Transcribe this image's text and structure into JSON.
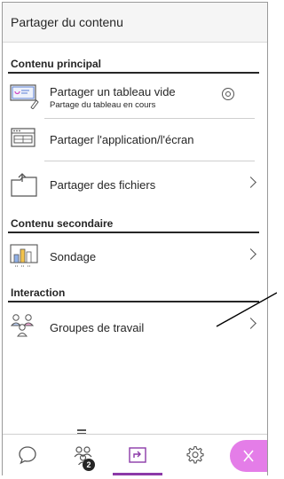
{
  "panel": {
    "title": "Partager du contenu"
  },
  "sections": {
    "primary": {
      "title": "Contenu principal",
      "items": [
        {
          "label": "Partager un tableau vide",
          "sub": "Partage du tableau en cours",
          "icon": "whiteboard-icon",
          "action_icon": "stop-sharing-icon"
        },
        {
          "label": "Partager l'application/l'écran",
          "icon": "screen-share-icon"
        },
        {
          "label": "Partager des fichiers",
          "icon": "file-share-icon",
          "action_icon": "chevron-right-icon"
        }
      ]
    },
    "secondary": {
      "title": "Contenu secondaire",
      "items": [
        {
          "label": "Sondage",
          "icon": "poll-icon",
          "action_icon": "chevron-right-icon"
        }
      ]
    },
    "interaction": {
      "title": "Interaction",
      "items": [
        {
          "label": "Groupes de travail",
          "icon": "breakout-groups-icon",
          "action_icon": "chevron-right-icon"
        }
      ]
    }
  },
  "bottom_nav": {
    "tabs": [
      {
        "name": "chat-tab",
        "icon": "chat-bubble-icon"
      },
      {
        "name": "attendees-tab",
        "icon": "attendees-icon",
        "badge": "2"
      },
      {
        "name": "share-content-tab",
        "icon": "share-content-icon",
        "active": true
      },
      {
        "name": "settings-tab",
        "icon": "gear-icon"
      }
    ],
    "close": {
      "icon": "close-icon"
    }
  },
  "colors": {
    "accent": "#8c3aa8",
    "close_bg": "#e47de8",
    "chip_bg": "#f5f5f5"
  }
}
